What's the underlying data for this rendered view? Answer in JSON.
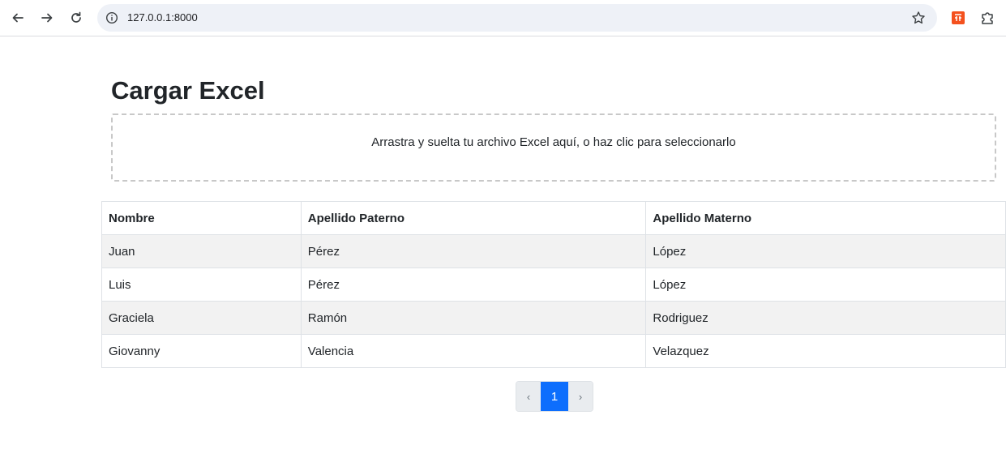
{
  "browser": {
    "url": "127.0.0.1:8000",
    "icons": [
      "back-arrow-icon",
      "forward-arrow-icon",
      "reload-icon",
      "site-info-icon",
      "bookmark-star-icon",
      "extension-app-icon",
      "extensions-puzzle-icon"
    ]
  },
  "page": {
    "title": "Cargar Excel",
    "dropzone_text": "Arrastra y suelta tu archivo Excel aquí, o haz clic para seleccionarlo"
  },
  "table": {
    "headers": [
      "Nombre",
      "Apellido Paterno",
      "Apellido Materno"
    ],
    "rows": [
      [
        "Juan",
        "Pérez",
        "López"
      ],
      [
        "Luis",
        "Pérez",
        "López"
      ],
      [
        "Graciela",
        "Ramón",
        "Rodriguez"
      ],
      [
        "Giovanny",
        "Valencia",
        "Velazquez"
      ]
    ]
  },
  "pagination": {
    "prev_label": "‹",
    "current_page": "1",
    "next_label": "›"
  },
  "colors": {
    "accent": "#0d6efd",
    "striped_row": "#f2f2f2",
    "omnibox_bg": "#eef1f7",
    "extension_orange": "#f4511e"
  }
}
